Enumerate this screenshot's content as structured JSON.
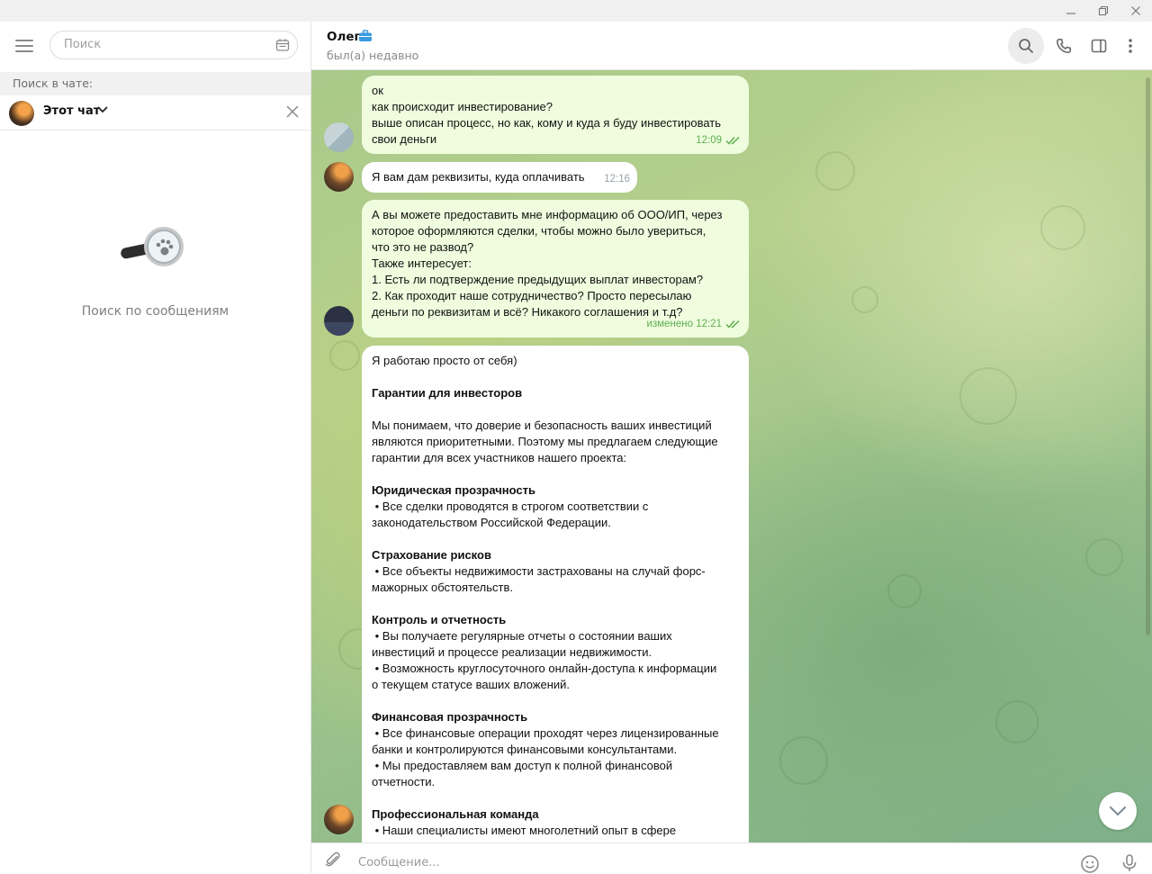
{
  "sidebar": {
    "search_placeholder": "Поиск",
    "search_in_chat_label": "Поиск в чате:",
    "this_chat_label": "Этот чат",
    "empty_text": "Поиск по сообщениям"
  },
  "header": {
    "name": "Олег",
    "status": "был(а) недавно"
  },
  "messages": [
    {
      "direction": "out",
      "lines": [
        "ок",
        "как происходит инвестирование?",
        "выше описан процесс, но как, кому и куда я буду инвестировать",
        "свои деньги"
      ],
      "time": "12:09"
    },
    {
      "direction": "in",
      "lines": [
        "Я вам дам реквизиты, куда оплачивать"
      ],
      "time": "12:16"
    },
    {
      "direction": "out",
      "lines": [
        "А вы можете предоставить мне информацию об ООО/ИП, через",
        "которое оформляются сделки, чтобы можно было увериться,",
        "что это не развод?",
        "Также интересует:",
        "1. Есть ли подтверждение предыдущих выплат инвесторам?",
        "2. Как проходит наше сотрудничество? Просто пересылаю",
        "деньги по реквизитам и всё? Никакого соглашения и т.д?"
      ],
      "time": "изменено 12:21"
    },
    {
      "direction": "in",
      "lines": [
        "Я работаю просто от себя)",
        "",
        "Гарантии для инвесторов",
        "",
        "Мы понимаем, что доверие и безопасность ваших инвестиций",
        "являются приоритетными. Поэтому мы предлагаем следующие",
        "гарантии для всех участников нашего проекта:",
        "",
        "Юридическая прозрачность",
        " • Все сделки проводятся в строгом соответствии с",
        "законодательством Российской Федерации.",
        "",
        "Страхование рисков",
        " • Все объекты недвижимости застрахованы на случай форс-",
        "мажорных обстоятельств.",
        "",
        "Контроль и отчетность",
        " • Вы получаете регулярные отчеты о состоянии ваших",
        "инвестиций и процессе реализации недвижимости.",
        " • Возможность круглосуточного онлайн-доступа к информации",
        "о текущем статусе ваших вложений.",
        "",
        "Финансовая прозрачность",
        " • Все финансовые операции проходят через лицензированные",
        "банки и контролируются финансовыми консультантами.",
        " • Мы предоставляем вам доступ к полной финансовой",
        "отчетности.",
        "",
        "Профессиональная команда",
        " • Наши специалисты имеют многолетний опыт в сфере"
      ],
      "bold_line_indices": [
        2,
        8,
        12,
        16,
        22,
        28
      ]
    }
  ],
  "composer": {
    "placeholder": "Сообщение..."
  },
  "colors": {
    "outgoing_bubble": "#effdde",
    "incoming_bubble": "#ffffff",
    "time_out": "#5fae50",
    "accent": "#4fa3e0"
  },
  "icons": [
    "menu-icon",
    "calendar-icon",
    "chevron-down-icon",
    "close-icon",
    "search-icon",
    "phone-icon",
    "sidebar-toggle-icon",
    "more-icon",
    "briefcase-icon",
    "double-check-icon",
    "chevron-down-icon",
    "paperclip-icon",
    "emoji-icon",
    "microphone-icon"
  ]
}
